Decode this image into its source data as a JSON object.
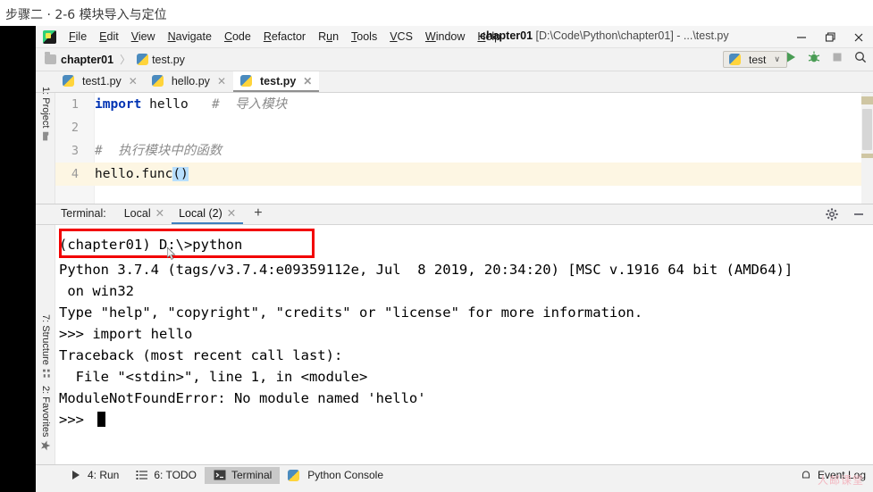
{
  "slide": {
    "title": "步骤二 · 2-6 模块导入与定位"
  },
  "window": {
    "app_icon": "pycharm-logo-icon",
    "title_project": "chapter01",
    "title_path": "[D:\\Code\\Python\\chapter01] - ...\\test.py",
    "controls": {
      "minimize": "—",
      "maximize": "❐",
      "close": "✕"
    }
  },
  "menu": {
    "items": [
      {
        "label": "File",
        "mnemonic": "F",
        "rest": "ile"
      },
      {
        "label": "Edit",
        "mnemonic": "E",
        "rest": "dit"
      },
      {
        "label": "View",
        "mnemonic": "V",
        "rest": "iew"
      },
      {
        "label": "Navigate",
        "mnemonic": "N",
        "rest": "avigate"
      },
      {
        "label": "Code",
        "mnemonic": "C",
        "rest": "ode"
      },
      {
        "label": "Refactor",
        "mnemonic": "R",
        "rest": "efactor"
      },
      {
        "label": "Run",
        "mnemonic": "u",
        "pre": "R",
        "rest": "n"
      },
      {
        "label": "Tools",
        "mnemonic": "T",
        "rest": "ools"
      },
      {
        "label": "VCS",
        "mnemonic": "V",
        "rest": "CS"
      },
      {
        "label": "Window",
        "mnemonic": "W",
        "rest": "indow"
      },
      {
        "label": "Help",
        "mnemonic": "H",
        "rest": "elp"
      }
    ]
  },
  "breadcrumb": {
    "project": "chapter01",
    "separator": "〉",
    "file": "test.py"
  },
  "toolbar": {
    "run_config": "test",
    "run_config_caret": "∨",
    "run_icon": "run-play-icon",
    "debug_icon": "debug-bug-icon",
    "stop_icon": "stop-square-icon",
    "search_icon": "search-icon"
  },
  "editor_tabs": [
    {
      "label": "test1.py",
      "active": false,
      "close": "✕"
    },
    {
      "label": "hello.py",
      "active": false,
      "close": "✕"
    },
    {
      "label": "test.py",
      "active": true,
      "close": "✕"
    }
  ],
  "editor": {
    "lines": [
      {
        "number": "1",
        "segments": [
          {
            "text": "import",
            "style": "kw"
          },
          {
            "text": " hello   ",
            "style": "plain"
          },
          {
            "text": "#  导入模块",
            "style": "cmt"
          }
        ]
      },
      {
        "number": "2",
        "segments": []
      },
      {
        "number": "3",
        "segments": [
          {
            "text": "#  执行模块中的函数",
            "style": "cmt"
          }
        ]
      },
      {
        "number": "4",
        "segments": [
          {
            "text": "hello.func",
            "style": "plain"
          },
          {
            "text": "()",
            "style": "paren-hl"
          }
        ]
      }
    ],
    "highlighted_line": "4"
  },
  "terminal_tabs": {
    "label": "Terminal:",
    "tabs": [
      {
        "label": "Local",
        "active": false,
        "close": "✕"
      },
      {
        "label": "Local (2)",
        "active": true,
        "close": "✕"
      }
    ],
    "add": "+",
    "settings_icon": "gear-icon",
    "hide_icon": "minimize-icon"
  },
  "terminal": {
    "lines": [
      "(chapter01) D:\\>python",
      "Python 3.7.4 (tags/v3.7.4:e09359112e, Jul  8 2019, 20:34:20) [MSC v.1916 64 bit (AMD64)]",
      " on win32",
      "Type \"help\", \"copyright\", \"credits\" or \"license\" for more information.",
      ">>> import hello",
      "Traceback (most recent call last):",
      "  File \"<stdin>\", line 1, in <module>",
      "ModuleNotFoundError: No module named 'hello'",
      ">>> "
    ],
    "prompt_highlight_color": "#f20000",
    "cursor": "block-cursor"
  },
  "left_tool_buttons": [
    {
      "label": "1: Project",
      "mnemonic": "1",
      "rest": ": Project",
      "icon": "project-folder-icon"
    },
    {
      "label": "7: Structure",
      "mnemonic": "7",
      "rest": ": Structure",
      "icon": "structure-icon"
    },
    {
      "label": "2: Favorites",
      "mnemonic": "2",
      "rest": ": Favorites",
      "icon": "star-icon"
    }
  ],
  "statusbar": {
    "items": [
      {
        "label": "4: Run",
        "mnemonic": "4",
        "rest": ": Run",
        "icon": "run-play-icon",
        "active": false
      },
      {
        "label": "6: TODO",
        "mnemonic": "6",
        "rest": ": TODO",
        "icon": "todo-list-icon",
        "active": false
      },
      {
        "label": "Terminal",
        "icon": "terminal-icon",
        "active": true
      },
      {
        "label": "Python Console",
        "icon": "python-icon",
        "active": false
      }
    ],
    "event_log": "Event Log",
    "event_log_icon": "bell-icon",
    "watermark": "人邮课堂"
  }
}
